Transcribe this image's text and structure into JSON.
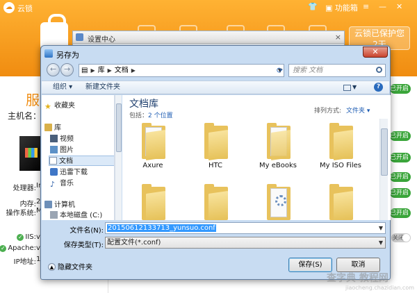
{
  "app": {
    "title": "云锁",
    "feature_box": "功能箱",
    "protect_text": "云锁已保护您",
    "protect_days": "2天",
    "section_title": "服",
    "hostname_label": "主机名：",
    "info_labels": [
      "处理器:",
      "内存:",
      "操作系统:",
      "IIS:",
      "Apache:",
      "IP地址:"
    ],
    "info_values": [
      "In",
      "2",
      "M",
      "v",
      "v",
      "1"
    ],
    "status_on": "已开启",
    "status_off": "关闭"
  },
  "settings_window": {
    "title": "设置中心",
    "close": "×"
  },
  "dialog": {
    "title": "另存为",
    "close": "✕",
    "address": {
      "root": "库",
      "current": "文档"
    },
    "search_placeholder": "搜索 文档",
    "toolbar": {
      "organize": "组织 ▾",
      "new_folder": "新建文件夹"
    },
    "nav": {
      "favorites": "收藏夹",
      "libraries": "库",
      "lib_items": [
        "视频",
        "图片",
        "文档",
        "迅雷下载",
        "音乐"
      ],
      "computer": "计算机",
      "disk": "本地磁盘 (C:)"
    },
    "library": {
      "title": "文档库",
      "includes_prefix": "包括：",
      "includes_link": "2 个位置",
      "arrange_label": "排列方式:",
      "arrange_value": "文件夹 ▾"
    },
    "folders": [
      "Axure",
      "HTC",
      "My eBooks",
      "My ISO Files",
      "",
      "",
      "",
      ""
    ],
    "filename_label": "文件名(N):",
    "filename_value": "20150612133713_yunsuo.conf",
    "filetype_label": "保存类型(T):",
    "filetype_value": "配置文件(*.conf)",
    "hide_folders": "隐藏文件夹",
    "save_button": "保存(S)",
    "cancel_button": "取消"
  },
  "watermark": {
    "main": "查字典 教程网",
    "sub": "jiaocheng.chazidian.com"
  },
  "colors": {
    "app_orange": "#f08c10",
    "status_green": "#3aa53a",
    "selection_blue": "#3399ff"
  }
}
